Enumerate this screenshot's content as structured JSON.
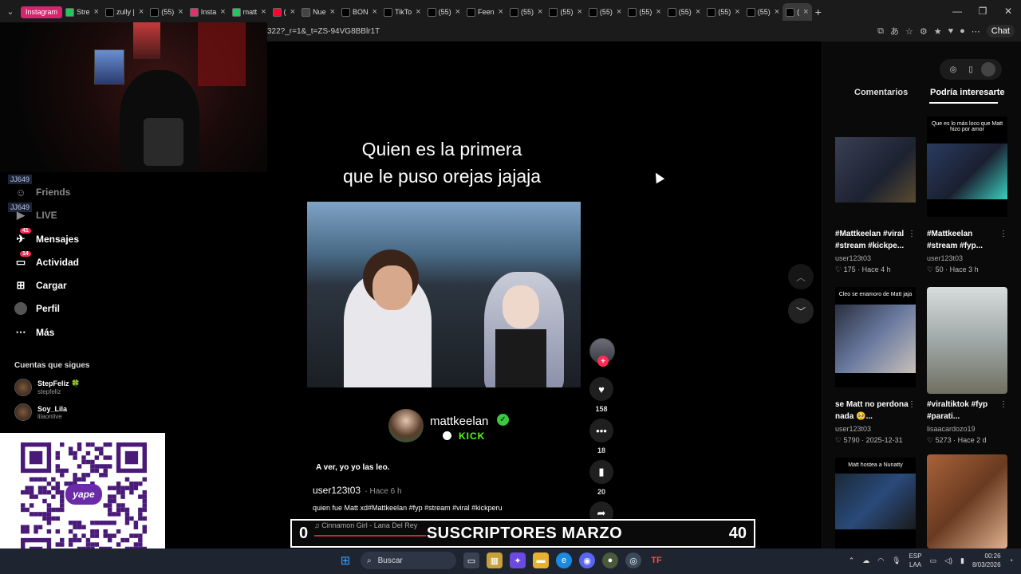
{
  "browser": {
    "tabs": [
      {
        "label": "Instagram",
        "kind": "pill",
        "color": "#d6246e"
      },
      {
        "label": "Stre",
        "color": "#22c55e"
      },
      {
        "label": "zully |",
        "color": "#000000"
      },
      {
        "label": "(55)",
        "color": "#000000"
      },
      {
        "label": "Insta",
        "color": "#e1306c"
      },
      {
        "label": "matt",
        "color": "#22c55e"
      },
      {
        "label": "(",
        "color": "#ff0033"
      },
      {
        "label": "Nue",
        "color": "#444444"
      },
      {
        "label": "BON",
        "color": "#000000"
      },
      {
        "label": "TikTo",
        "color": "#000000"
      },
      {
        "label": "(55)",
        "color": "#000000"
      },
      {
        "label": "Feen",
        "color": "#000000"
      },
      {
        "label": "(55)",
        "color": "#000000"
      },
      {
        "label": "(55)",
        "color": "#000000"
      },
      {
        "label": "(55)",
        "color": "#000000"
      },
      {
        "label": "(55)",
        "color": "#000000"
      },
      {
        "label": "(55)",
        "color": "#000000"
      },
      {
        "label": "(55)",
        "color": "#000000"
      },
      {
        "label": "(55)",
        "color": "#000000"
      },
      {
        "label": "(",
        "color": "#000000",
        "active": true
      }
    ],
    "url": "322?_r=1&_t=ZS-94VG8BBlr1T",
    "chat_label": "Chat"
  },
  "sidebar": {
    "chips": [
      "JJ649",
      "JJ649"
    ],
    "items": [
      {
        "label": "Friends",
        "icon": "friends-icon",
        "dim": true
      },
      {
        "label": "LIVE",
        "icon": "live-icon",
        "dim": true
      },
      {
        "label": "Mensajes",
        "icon": "messages-icon",
        "badge": "41"
      },
      {
        "label": "Actividad",
        "icon": "activity-icon",
        "badge": "14"
      },
      {
        "label": "Cargar",
        "icon": "upload-icon"
      },
      {
        "label": "Perfil",
        "icon": "profile-icon"
      },
      {
        "label": "Más",
        "icon": "more-icon"
      }
    ],
    "following_title": "Cuentas que sigues",
    "following": [
      {
        "name": "StepFeliz 🍀",
        "handle": "stepfeliz"
      },
      {
        "name": "Soy_Lila",
        "handle": "lilaonlive"
      }
    ]
  },
  "qr": {
    "brand": "yape"
  },
  "video": {
    "caption_line1": "Quien es la primera",
    "caption_line2": "que le puso orejas jajaja",
    "creator_name": "mattkeelan",
    "creator_platform": "KICK",
    "subtitle": "A ver, yo yo las leo.",
    "author": "user123t03",
    "time": "· Hace 6 h",
    "description": "quien fue Matt xd#Mattkeelan #fyp #stream #viral #kickperu",
    "likes": "158",
    "comments": "18",
    "saves": "20"
  },
  "right_panel": {
    "tabs": [
      "Comentarios",
      "Podría interesarte"
    ],
    "cards": [
      {
        "thumb_text": "",
        "title": "#Mattkeelan #viral #stream #kickpe...",
        "user": "user123t03",
        "meta": "♡ 175 · Hace 4 h"
      },
      {
        "thumb_text": "Que es lo más loco que Matt hizo por amor",
        "title": "#Mattkeelan #stream #fyp...",
        "user": "user123t03",
        "meta": "♡ 50 · Hace 3 h"
      },
      {
        "thumb_text": "Cleo se enamoro de Matt jaja",
        "title": "se Matt no perdona nada 🥺...",
        "user": "user123t03",
        "meta": "♡ 5790 · 2025-12-31"
      },
      {
        "thumb_text": "",
        "title": "#viraltiktok #fyp #parati...",
        "user": "lisaacardozo19",
        "meta": "♡ 5273 · Hace 2 d"
      },
      {
        "thumb_text": "Matt hostea a Nunatty",
        "title": "",
        "user": "",
        "meta": ""
      },
      {
        "thumb_text": "",
        "title": "",
        "user": "",
        "meta": ""
      }
    ]
  },
  "banner": {
    "left": "0",
    "title": "SUSCRIPTORES MARZO",
    "right": "40",
    "song": "♫  Cinnamon Girl - Lana Del Rey"
  },
  "taskbar": {
    "search": "Buscar",
    "lang_line1": "ESP",
    "lang_line2": "LAA",
    "time": "00:26",
    "date": "8/03/2026"
  },
  "colors": {
    "accent": "#fe2c55",
    "kick": "#53fc18",
    "verify": "#3ac940"
  }
}
